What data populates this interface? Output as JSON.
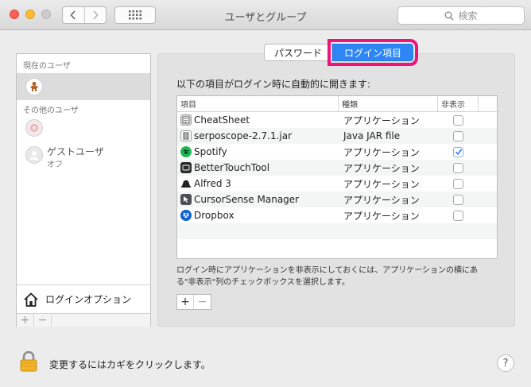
{
  "window": {
    "title": "ユーザとグループ"
  },
  "search": {
    "placeholder": "検索"
  },
  "sidebar": {
    "current_users_header": "現在のユーザ",
    "other_users_header": "その他のユーザ",
    "guest": {
      "name": "ゲストユーザ",
      "status": "オフ"
    },
    "login_options_label": "ログインオプション",
    "add_label": "+",
    "remove_label": "−"
  },
  "tabs": [
    {
      "label": "パスワード",
      "active": false
    },
    {
      "label": "ログイン項目",
      "active": true
    }
  ],
  "login_items": {
    "instruction": "以下の項目がログイン時に自動的に開きます:",
    "columns": {
      "item": "項目",
      "kind": "種類",
      "hide": "非表示"
    },
    "rows": [
      {
        "name": "CheatSheet",
        "kind": "アプリケーション",
        "hidden": false,
        "icon": "cheatsheet-icon"
      },
      {
        "name": "serposcope-2.7.1.jar",
        "kind": "Java JAR file",
        "hidden": false,
        "icon": "jar-icon"
      },
      {
        "name": "Spotify",
        "kind": "アプリケーション",
        "hidden": true,
        "icon": "spotify-icon"
      },
      {
        "name": "BetterTouchTool",
        "kind": "アプリケーション",
        "hidden": false,
        "icon": "bettertouchtool-icon"
      },
      {
        "name": "Alfred 3",
        "kind": "アプリケーション",
        "hidden": false,
        "icon": "alfred-icon"
      },
      {
        "name": "CursorSense Manager",
        "kind": "アプリケーション",
        "hidden": false,
        "icon": "cursorsense-icon"
      },
      {
        "name": "Dropbox",
        "kind": "アプリケーション",
        "hidden": false,
        "icon": "dropbox-icon"
      }
    ],
    "note": "ログイン時にアプリケーションを非表示にしておくには、アプリケーションの横にある\"非表示\"列のチェックボックスを選択します。",
    "add_label": "+",
    "remove_label": "−"
  },
  "footer": {
    "lock_label": "変更するにはカギをクリックします。",
    "help_label": "?"
  },
  "colors": {
    "accent": "#2e86f5",
    "highlight": "#f0137b",
    "spotify": "#1db954"
  }
}
